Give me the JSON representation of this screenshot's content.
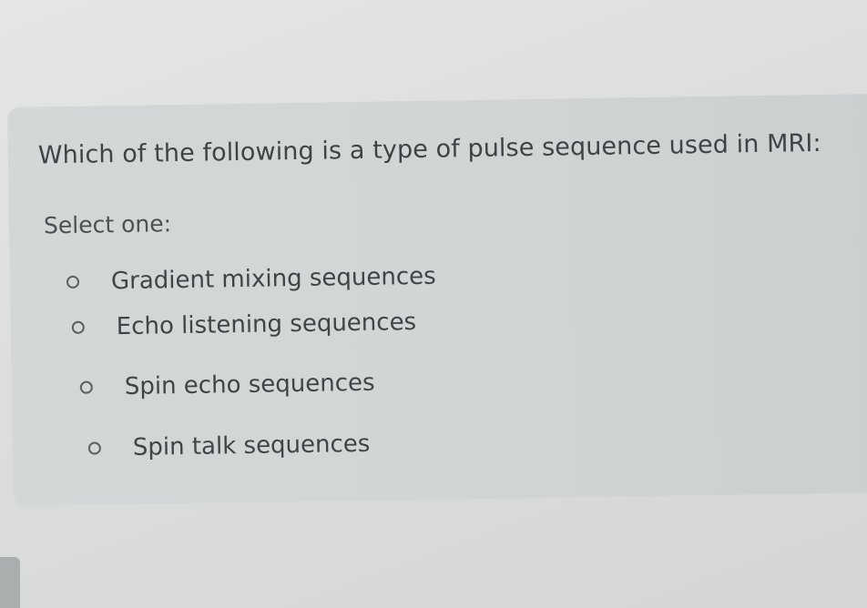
{
  "question": {
    "text": "Which of the following is a type of pulse sequence used in MRI:",
    "prompt": "Select one:",
    "options": [
      {
        "label": "Gradient mixing sequences",
        "selected": false
      },
      {
        "label": "Echo listening sequences",
        "selected": false
      },
      {
        "label": "Spin echo sequences",
        "selected": false
      },
      {
        "label": "Spin talk sequences",
        "selected": false
      }
    ]
  }
}
